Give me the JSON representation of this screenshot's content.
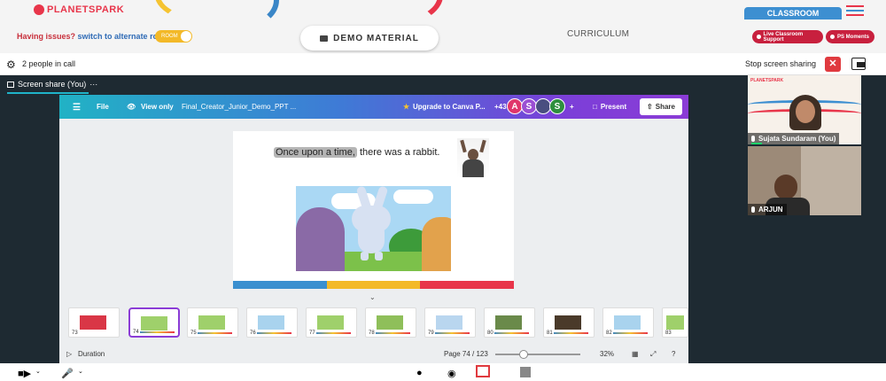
{
  "header": {
    "logo_text": "PLANETSPARK",
    "issues_text": "Having issues?",
    "switch_room_link": "switch to alternate room",
    "room_toggle_label": "ROOM",
    "demo_material_label": "DEMO MATERIAL",
    "curriculum_label": "CURRICULUM",
    "classroom_tab": "CLASSROOM",
    "live_support_label": "Live Classroom Support",
    "ps_moments_label": "PS Moments"
  },
  "call": {
    "people_count": "2 people in call",
    "stop_sharing_label": "Stop screen sharing"
  },
  "screen_share": {
    "title": "Screen share (You)",
    "more": "···"
  },
  "canva": {
    "file_menu": "File",
    "view_only": "View only",
    "doc_title": "Final_Creator_Junior_Demo_PPT ...",
    "upgrade": "Upgrade to Canva P...",
    "collab_count": "+43",
    "avatars": [
      {
        "letter": "A",
        "color": "#e0356b"
      },
      {
        "letter": "S",
        "color": "#9b4fd3"
      },
      {
        "letter": "",
        "color": "#4a4e80"
      },
      {
        "letter": "S",
        "color": "#2f8f3e"
      }
    ],
    "add": "+",
    "present": "Present",
    "share": "Share",
    "slide_text_highlight": "Once upon a time,",
    "slide_text_rest": " there was a rabbit.",
    "slide_bar_colors": [
      "#3a8fcf",
      "#f3b928",
      "#e8354a"
    ],
    "thumbnails": [
      "73",
      "74",
      "75",
      "76",
      "77",
      "78",
      "79",
      "80",
      "81",
      "82",
      "83"
    ],
    "selected_thumbnail": "74",
    "duration": "Duration",
    "page_indicator": "Page 74 / 123",
    "zoom": "32%",
    "help": "?"
  },
  "participants": [
    {
      "name": "Sujata Sundaram (You)"
    },
    {
      "name": "ARJUN"
    }
  ],
  "tile_logo": "PLANETSPARK",
  "colors": {
    "brand_red": "#e8354a",
    "brand_blue": "#3d8fd1",
    "dark_bg": "#1e2a32"
  }
}
